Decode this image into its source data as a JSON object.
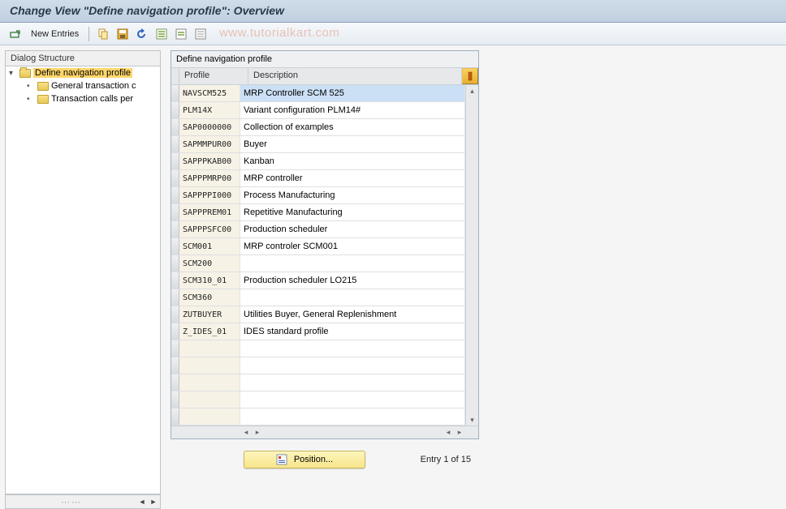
{
  "title": "Change View \"Define navigation profile\": Overview",
  "toolbar": {
    "new_entries": "New Entries"
  },
  "watermark": "www.tutorialkart.com",
  "sidebar": {
    "header": "Dialog Structure",
    "root": "Define navigation profile",
    "child1": "General transaction c",
    "child2": "Transaction calls per"
  },
  "table": {
    "title": "Define navigation profile",
    "col_profile": "Profile",
    "col_desc": "Description",
    "hscroll_left_group": "",
    "rows": [
      {
        "profile": "NAVSCM525",
        "desc": "MRP Controller SCM 525",
        "selected": true
      },
      {
        "profile": "PLM14X",
        "desc": "Variant configuration PLM14#"
      },
      {
        "profile": "SAP0000000",
        "desc": "Collection of examples"
      },
      {
        "profile": "SAPMMPUR00",
        "desc": "Buyer"
      },
      {
        "profile": "SAPPPKAB00",
        "desc": "Kanban"
      },
      {
        "profile": "SAPPPMRP00",
        "desc": "MRP controller"
      },
      {
        "profile": "SAPPPPI000",
        "desc": "Process Manufacturing"
      },
      {
        "profile": "SAPPPREM01",
        "desc": "Repetitive Manufacturing"
      },
      {
        "profile": "SAPPPSFC00",
        "desc": "Production scheduler"
      },
      {
        "profile": "SCM001",
        "desc": "MRP controler SCM001"
      },
      {
        "profile": "SCM200",
        "desc": ""
      },
      {
        "profile": "SCM310_01",
        "desc": "Production scheduler LO215"
      },
      {
        "profile": "SCM360",
        "desc": ""
      },
      {
        "profile": "ZUTBUYER",
        "desc": "Utilities Buyer, General Replenishment"
      },
      {
        "profile": "Z_IDES_01",
        "desc": "IDES standard profile"
      }
    ]
  },
  "footer": {
    "position_label": "Position...",
    "entry_text": "Entry 1 of 15"
  }
}
